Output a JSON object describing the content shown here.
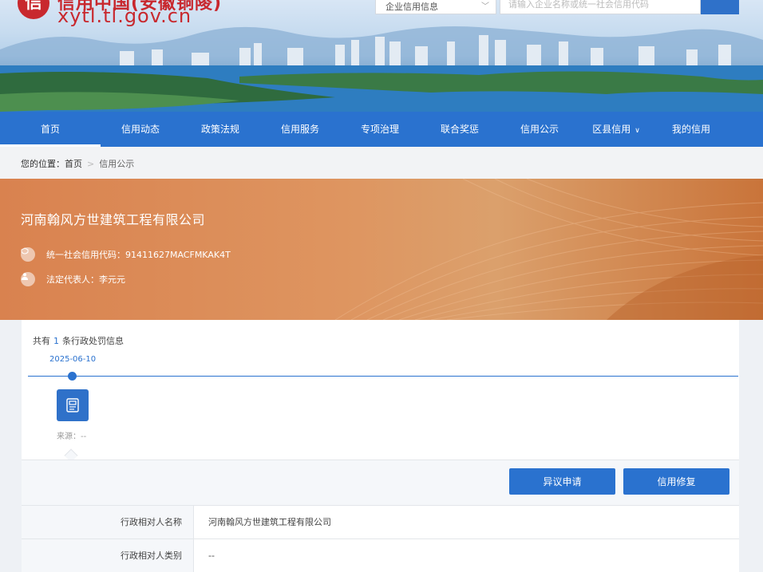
{
  "header": {
    "logo_glyph": "信",
    "site_title": "信用中国(安徽铜陵)",
    "site_url": "xytl.tl.gov.cn",
    "search": {
      "category": "企业信用信息",
      "placeholder": "请输入企业名称或统一社会信用代码",
      "button_icon": "search-icon"
    }
  },
  "nav": {
    "items": [
      {
        "label": "首页",
        "active": true
      },
      {
        "label": "信用动态"
      },
      {
        "label": "政策法规"
      },
      {
        "label": "信用服务"
      },
      {
        "label": "专项治理"
      },
      {
        "label": "联合奖惩"
      },
      {
        "label": "信用公示"
      },
      {
        "label": "区县信用",
        "has_dropdown": true
      },
      {
        "label": "我的信用"
      }
    ]
  },
  "breadcrumb": {
    "prefix": "您的位置：",
    "home": "首页",
    "separator": ">",
    "current": "信用公示"
  },
  "company": {
    "name": "河南翰风方世建筑工程有限公司",
    "credit_code_label": "统一社会信用代码：",
    "credit_code": "91411627MACFMKAK4T",
    "legal_rep_label": "法定代表人：",
    "legal_rep": "李元元"
  },
  "records": {
    "count_prefix": "共有",
    "count": "1",
    "count_suffix": "条行政处罚信息",
    "timeline": [
      {
        "date": "2025-06-10",
        "source_label": "来源：",
        "source": "--",
        "icon": "document-icon"
      }
    ]
  },
  "actions": {
    "objection": "异议申请",
    "repair": "信用修复"
  },
  "details": [
    {
      "key": "行政相对人名称",
      "value": "河南翰风方世建筑工程有限公司"
    },
    {
      "key": "行政相对人类别",
      "value": "--"
    }
  ],
  "colors": {
    "brand_red": "#c8282e",
    "nav_blue": "#2a72cf",
    "hero_orange": "#d9824f"
  }
}
